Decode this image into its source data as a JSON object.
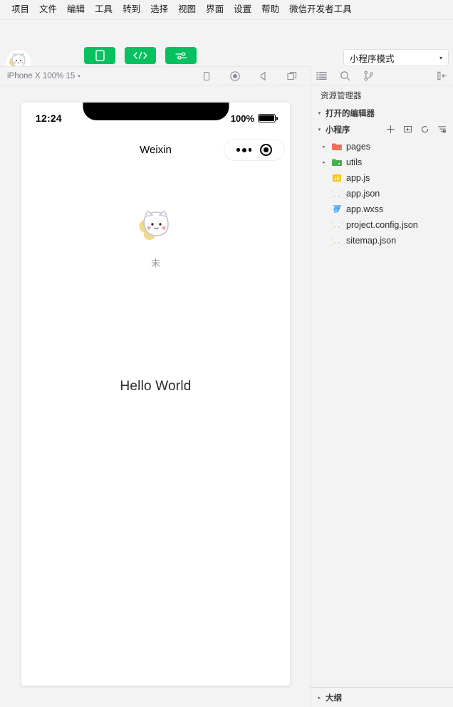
{
  "menubar": {
    "items": [
      {
        "label": "项目",
        "name": "menu-project"
      },
      {
        "label": "文件",
        "name": "menu-file"
      },
      {
        "label": "编辑",
        "name": "menu-edit"
      },
      {
        "label": "工具",
        "name": "menu-tools"
      },
      {
        "label": "转到",
        "name": "menu-goto"
      },
      {
        "label": "选择",
        "name": "menu-select"
      },
      {
        "label": "视图",
        "name": "menu-view"
      },
      {
        "label": "界面",
        "name": "menu-interface"
      },
      {
        "label": "设置",
        "name": "menu-settings"
      },
      {
        "label": "帮助",
        "name": "menu-help"
      },
      {
        "label": "微信开发者工具",
        "name": "menu-devtools"
      }
    ]
  },
  "toolbar": {
    "buttons": [
      {
        "label": "模拟器",
        "icon": "phone-icon"
      },
      {
        "label": "编辑器",
        "icon": "code-icon"
      },
      {
        "label": "调试器",
        "icon": "sliders-icon"
      }
    ],
    "mode_select": {
      "value": "小程序模式",
      "caret": "▾"
    },
    "accent_color": "#07c160"
  },
  "devicebar": {
    "device": "iPhone X 100% 15",
    "caret": "▾",
    "icons": [
      "phone-rotate-icon",
      "record-icon",
      "volume-icon",
      "windows-icon"
    ]
  },
  "simulator": {
    "statusbar": {
      "time": "12:24",
      "battery_percent": "100%"
    },
    "navbar": {
      "title": "Weixin"
    },
    "page": {
      "nickname": "未",
      "content_text": "Hello World"
    }
  },
  "rightpanel": {
    "toolbar_icons": [
      "explorer-icon",
      "search-icon",
      "git-branch-icon",
      "collapse-panel-icon"
    ],
    "title": "资源管理器",
    "sections": [
      {
        "label": "打开的编辑器",
        "name": "section-open-editors",
        "twisty": "▾"
      },
      {
        "label": "小程序",
        "name": "section-miniprogram",
        "twisty": "▾",
        "actions": [
          "new-file-icon",
          "new-folder-icon",
          "refresh-icon",
          "collapse-all-icon"
        ]
      }
    ],
    "tree": [
      {
        "label": "pages",
        "icon": "folder-red-icon",
        "twisty": "▸",
        "type": "folder"
      },
      {
        "label": "utils",
        "icon": "folder-green-icon",
        "twisty": "▸",
        "type": "folder"
      },
      {
        "label": "app.js",
        "icon": "js-file-icon",
        "twisty": "",
        "type": "file"
      },
      {
        "label": "app.json",
        "icon": "json-file-icon",
        "twisty": "",
        "type": "file"
      },
      {
        "label": "app.wxss",
        "icon": "css-file-icon",
        "twisty": "",
        "type": "file"
      },
      {
        "label": "project.config.json",
        "icon": "json-file-icon",
        "twisty": "",
        "type": "file"
      },
      {
        "label": "sitemap.json",
        "icon": "json-file-icon",
        "twisty": "",
        "type": "file"
      }
    ],
    "outline": {
      "label": "大纲",
      "twisty": "▸"
    }
  }
}
